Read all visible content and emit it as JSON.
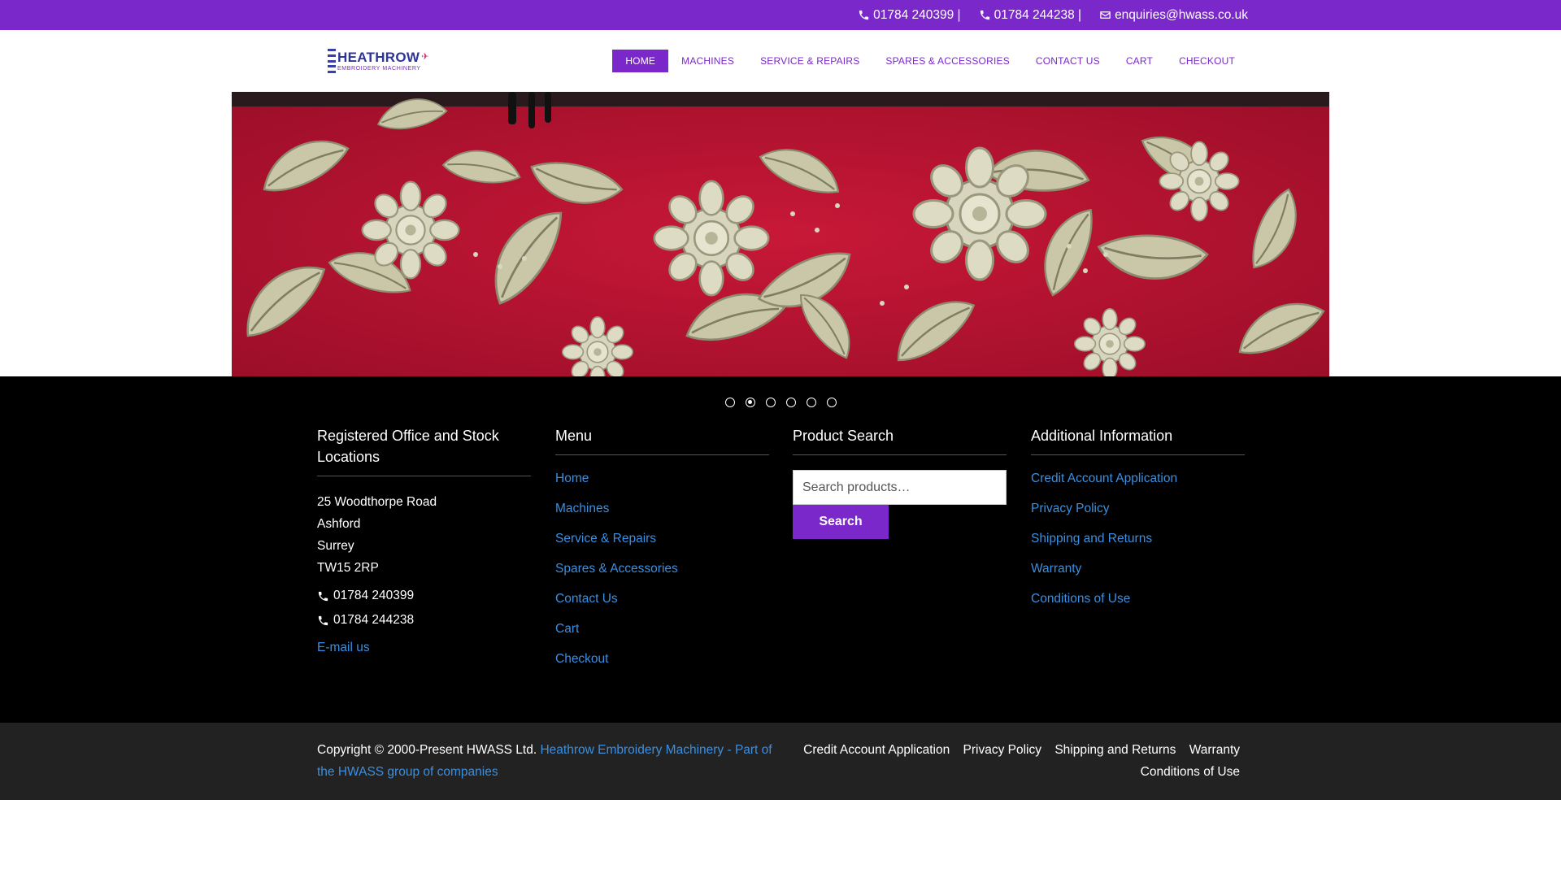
{
  "topbar": {
    "phone1": "01784 240399 |",
    "phone2": "01784 244238 |",
    "email": "enquiries@hwass.co.uk"
  },
  "logo": {
    "main": "HEATHROW",
    "sub": "EMBROIDERY MACHINERY"
  },
  "nav": {
    "items": [
      "HOME",
      "MACHINES",
      "SERVICE & REPAIRS",
      "SPARES & ACCESSORIES",
      "CONTACT US",
      "CART",
      "CHECKOUT"
    ],
    "active_index": 0
  },
  "slider": {
    "slide_count": 6,
    "active_slide": 2
  },
  "footer": {
    "office": {
      "title": "Registered Office and Stock Locations",
      "address": [
        "25 Woodthorpe Road",
        "Ashford",
        "Surrey",
        "TW15 2RP"
      ],
      "phone1": "01784 240399",
      "phone2": "01784 244238",
      "email_label": "E-mail us"
    },
    "menu": {
      "title": "Menu",
      "items": [
        "Home",
        "Machines",
        "Service & Repairs",
        "Spares & Accessories",
        "Contact Us",
        "Cart",
        "Checkout"
      ]
    },
    "search": {
      "title": "Product Search",
      "placeholder": "Search products…",
      "button": "Search"
    },
    "info": {
      "title": "Additional Information",
      "items": [
        "Credit Account Application",
        "Privacy Policy",
        "Shipping and Returns",
        "Warranty",
        "Conditions of Use"
      ]
    }
  },
  "bottom": {
    "copyright": "Copyright © 2000-Present HWASS Ltd. ",
    "copyright_link": "Heathrow Embroidery Machinery - Part of the HWASS group of companies",
    "links": [
      "Credit Account Application",
      "Privacy Policy",
      "Shipping and Returns",
      "Warranty",
      "Conditions of Use"
    ]
  },
  "colors": {
    "brand_purple": "#7a28c9",
    "link_blue": "#3b8fe0",
    "footer_bg": "#000000",
    "bottom_bg": "#222222"
  }
}
